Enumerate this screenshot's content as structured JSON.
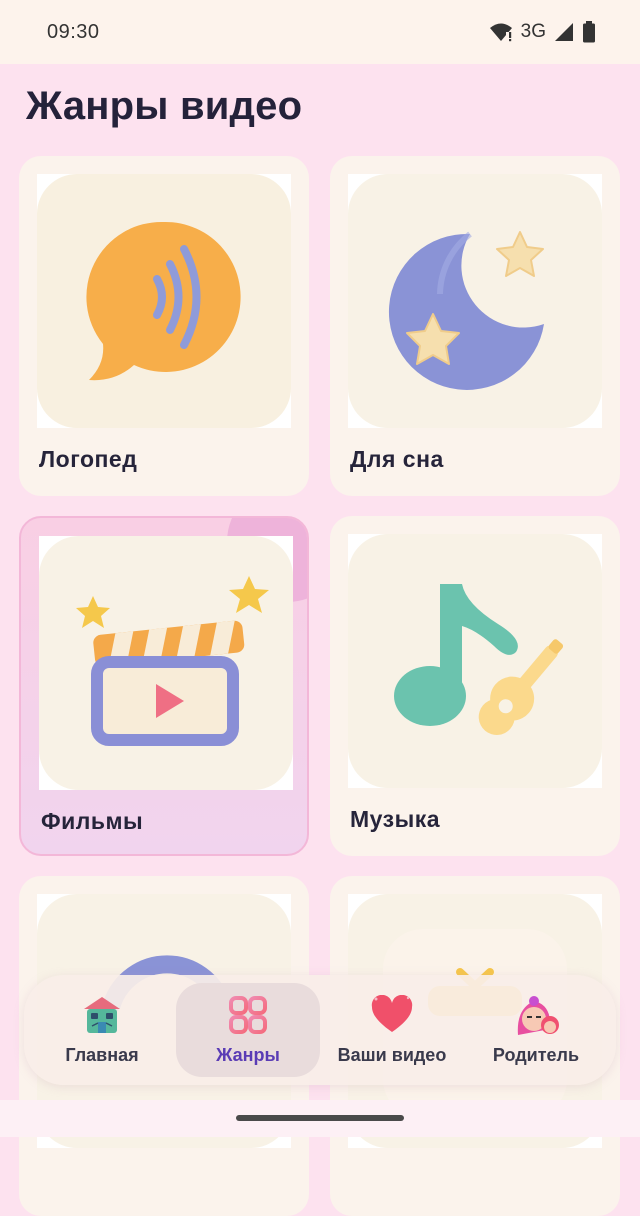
{
  "status_bar": {
    "time": "09:30",
    "network": "3G"
  },
  "page": {
    "title": "Жанры видео"
  },
  "genres": [
    {
      "label": "Логопед",
      "icon": "speech-bubble-icon"
    },
    {
      "label": "Для сна",
      "icon": "moon-stars-icon"
    },
    {
      "label": "Фильмы",
      "icon": "clapperboard-icon",
      "selected": true
    },
    {
      "label": "Музыка",
      "icon": "music-note-guitar-icon"
    },
    {
      "label": "",
      "icon": "globe-icon"
    },
    {
      "label": "",
      "icon": "tv-icon"
    }
  ],
  "nav": {
    "items": [
      {
        "label": "Главная",
        "icon": "house-icon"
      },
      {
        "label": "Жанры",
        "icon": "genres-grid-icon",
        "active": true
      },
      {
        "label": "Ваши видео",
        "icon": "heart-icon"
      },
      {
        "label": "Родитель",
        "icon": "parent-avatar-icon"
      }
    ]
  },
  "colors": {
    "background": "#fde2ef",
    "accent": "#5a3cb5",
    "card": "#fbf3ec"
  }
}
